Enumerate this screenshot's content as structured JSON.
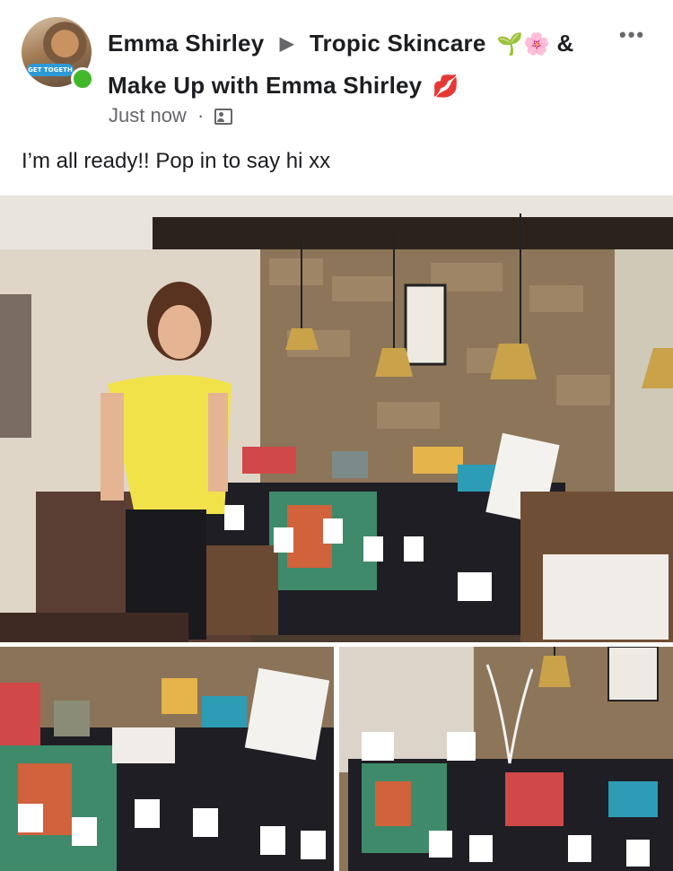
{
  "post": {
    "author": "Emma Shirley",
    "group": "Tropic Skincare",
    "group_emojis": "🌱🌸",
    "group_cont": "&",
    "group_line2": "Make Up with Emma Shirley",
    "group_line2_emoji": "💋",
    "avatar_badge": "GET TOGETH",
    "timestamp": "Just now",
    "separator": "·",
    "text": "I’m all ready!! Pop in to say hi xx",
    "more_label": "•••"
  },
  "photos": [
    {
      "name": "Event table with presenter"
    },
    {
      "name": "Product table close-up"
    },
    {
      "name": "Room with decorated tree"
    }
  ],
  "colors": {
    "online": "#42b72a",
    "secondary_text": "#65676b"
  }
}
